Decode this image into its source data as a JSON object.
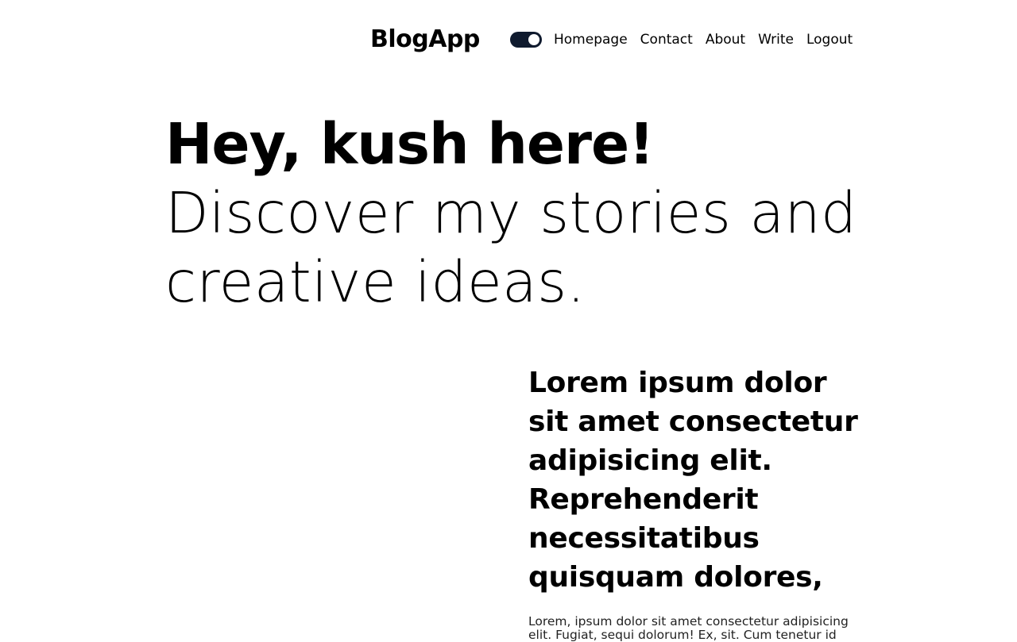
{
  "nav": {
    "logo": "BlogApp",
    "theme_toggle": "dark-mode-toggle",
    "links": [
      "Homepage",
      "Contact",
      "About",
      "Write",
      "Logout"
    ]
  },
  "hero": {
    "bold": "Hey, kush here!",
    "light": "Discover my stories and creative ideas."
  },
  "featured_post": {
    "title": "Lorem ipsum dolor sit amet consectetur adipisicing elit. Reprehenderit necessitatibus quisquam dolores,",
    "description": "Lorem, ipsum dolor sit amet consectetur adipisicing elit. Fugiat, sequi dolorum! Ex, sit. Cum tenetur id"
  },
  "colors": {
    "toggle_background": "#0f1a2e",
    "text": "#000000",
    "background": "#ffffff"
  }
}
